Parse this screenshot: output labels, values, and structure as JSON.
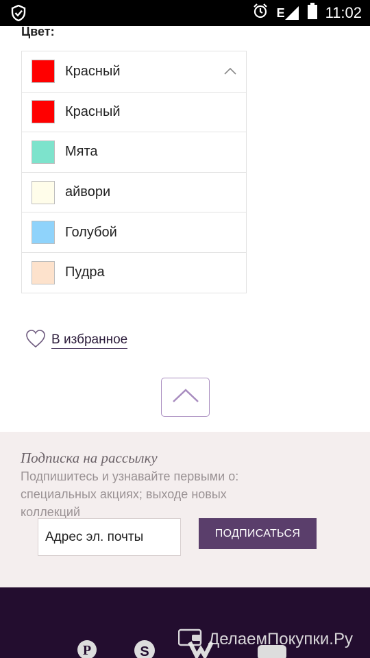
{
  "status_bar": {
    "network": "E",
    "time": "11:02"
  },
  "product": {
    "color_label": "Цвет:",
    "selected_color": {
      "name": "Красный",
      "swatch": "#ff0000"
    },
    "options": [
      {
        "name": "Красный",
        "swatch": "#ff0000"
      },
      {
        "name": "Мята",
        "swatch": "#7de3cc"
      },
      {
        "name": "айвори",
        "swatch": "#fffdea"
      },
      {
        "name": "Голубой",
        "swatch": "#8fd3fb"
      },
      {
        "name": "Пудра",
        "swatch": "#fde2cc"
      }
    ],
    "favorite_label": "В избранное"
  },
  "subscribe": {
    "title": "Подписка на рассылку",
    "text": "Подпишитесь и узнавайте первыми о: специальных акциях; выходе новых коллекций",
    "email_placeholder": "Адрес эл. почты",
    "button_label": "ПОДПИСАТЬСЯ"
  },
  "footer": {
    "social_icons": [
      "pinterest-icon",
      "skype-icon",
      "vk-icon",
      "youtube-icon"
    ],
    "watermark": "ДелаемПокупки.Ру"
  },
  "colors": {
    "accent": "#5a3e6b",
    "footer_bg": "#230d2f",
    "subscribe_bg": "#f4eeee"
  }
}
